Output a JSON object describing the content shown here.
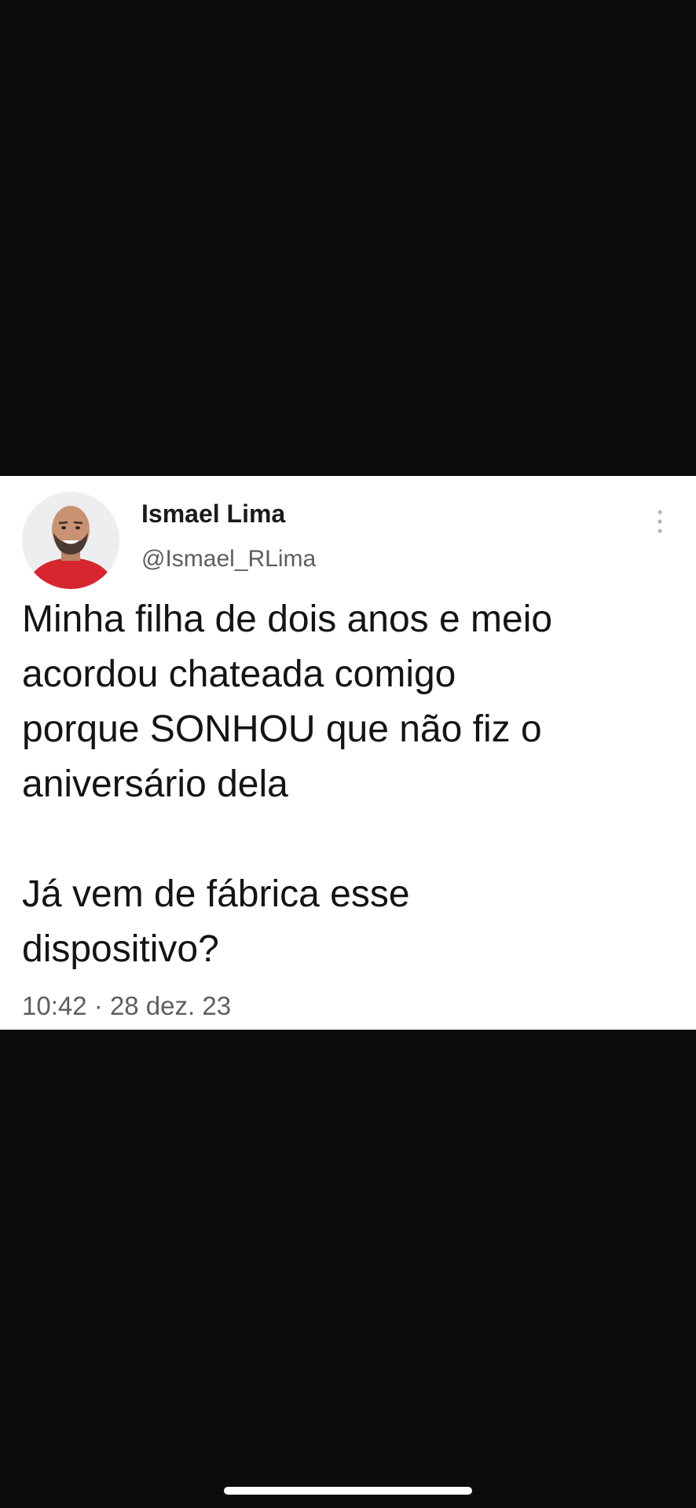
{
  "tweet": {
    "display_name": "Ismael Lima",
    "handle": "@Ismael_RLima",
    "text_lines": [
      "Minha filha de dois anos e meio",
      "acordou chateada comigo",
      "porque SONHOU que não fiz o",
      "aniversário dela",
      "",
      "Já vem de fábrica esse",
      "dispositivo?"
    ],
    "time": "10:42",
    "separator": "·",
    "date": "28 dez. 23",
    "avatar_icon": "profile-photo",
    "menu_icon": "more-vertical-icon"
  },
  "colors": {
    "background": "#0b0b0c",
    "card": "#ffffff",
    "text": "#141414",
    "secondary_text": "#5b5f63"
  }
}
